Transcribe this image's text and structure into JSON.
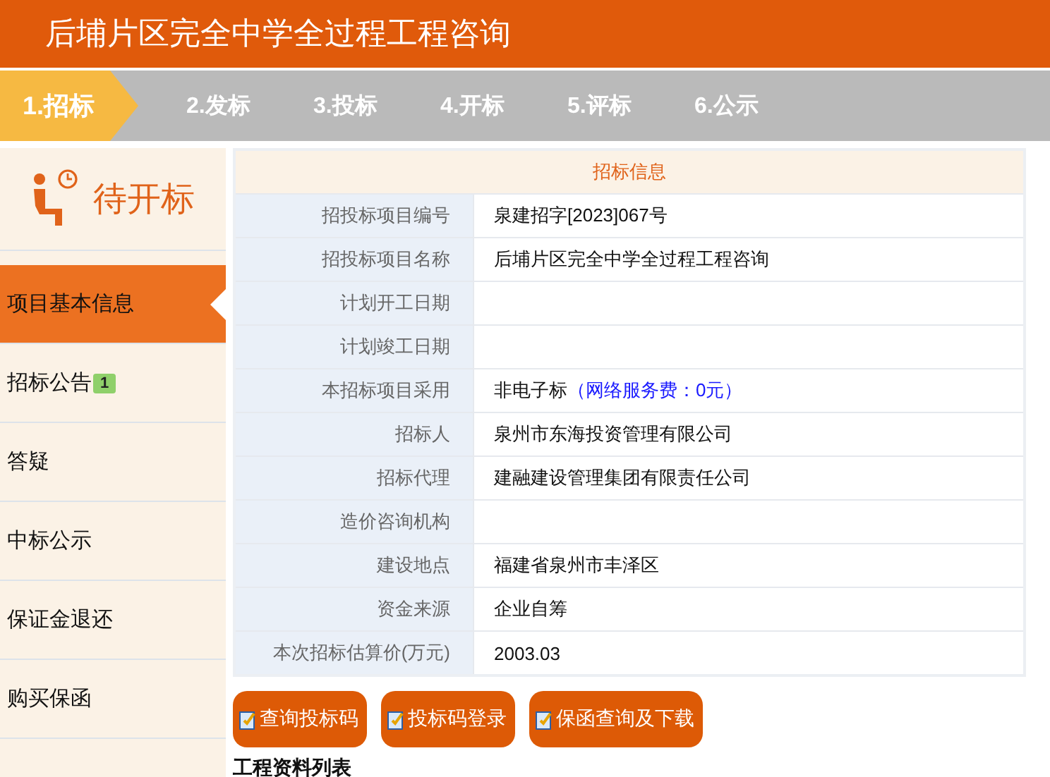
{
  "header": {
    "title": "后埔片区完全中学全过程工程咨询"
  },
  "steps": [
    {
      "label": "1.招标",
      "selected": true
    },
    {
      "label": "2.发标",
      "selected": false
    },
    {
      "label": "3.投标",
      "selected": false
    },
    {
      "label": "4.开标",
      "selected": false
    },
    {
      "label": "5.评标",
      "selected": false
    },
    {
      "label": "6.公示",
      "selected": false
    }
  ],
  "status": {
    "label": "待开标"
  },
  "sidebar": {
    "items": [
      {
        "label": "项目基本信息",
        "selected": true
      },
      {
        "label": "招标公告",
        "badge": "1",
        "selected": false
      },
      {
        "label": "答疑",
        "selected": false
      },
      {
        "label": "中标公示",
        "selected": false
      },
      {
        "label": "保证金退还",
        "selected": false
      },
      {
        "label": "购买保函",
        "selected": false
      }
    ]
  },
  "info_table": {
    "title": "招标信息",
    "rows": [
      {
        "label": "招投标项目编号",
        "value": "泉建招字[2023]067号"
      },
      {
        "label": "招投标项目名称",
        "value": "后埔片区完全中学全过程工程咨询"
      },
      {
        "label": "计划开工日期"
      },
      {
        "label": "计划竣工日期"
      },
      {
        "label": "本招标项目采用",
        "value": "非电子标",
        "note": "（网络服务费：0元）"
      },
      {
        "label": "招标人",
        "value": "泉州市东海投资管理有限公司"
      },
      {
        "label": "招标代理",
        "value": "建融建设管理集团有限责任公司"
      },
      {
        "label": "造价咨询机构"
      },
      {
        "label": "建设地点",
        "value": "福建省泉州市丰泽区"
      },
      {
        "label": "资金来源",
        "value": "企业自筹"
      },
      {
        "label": "本次招标估算价(万元)",
        "value": "2003.03"
      }
    ]
  },
  "buttons": [
    "查询投标码",
    "投标码登录",
    "保函查询及下载"
  ],
  "section_title": "工程资料列表"
}
